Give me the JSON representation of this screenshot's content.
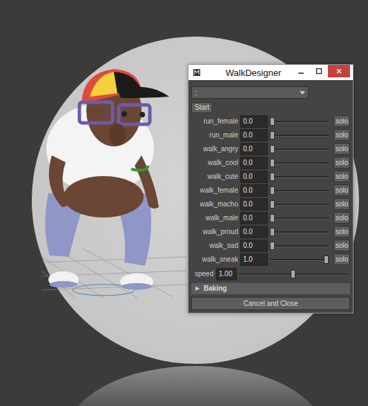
{
  "window": {
    "title": "WalkDesigner"
  },
  "dropdown": {
    "value": ":"
  },
  "start_button": {
    "label": "Start"
  },
  "presets": [
    {
      "name": "run_female",
      "value": "0.0",
      "level": 0,
      "button": "solo"
    },
    {
      "name": "run_male",
      "value": "0.0",
      "level": 0,
      "button": "solo"
    },
    {
      "name": "walk_angry",
      "value": "0.0",
      "level": 0,
      "button": "solo"
    },
    {
      "name": "walk_cool",
      "value": "0.0",
      "level": 0,
      "button": "solo"
    },
    {
      "name": "walk_cute",
      "value": "0.0",
      "level": 0,
      "button": "solo"
    },
    {
      "name": "walk_female",
      "value": "0.0",
      "level": 0,
      "button": "solo"
    },
    {
      "name": "walk_macho",
      "value": "0.0",
      "level": 0,
      "button": "solo"
    },
    {
      "name": "walk_male",
      "value": "0.0",
      "level": 0,
      "button": "solo"
    },
    {
      "name": "walk_proud",
      "value": "0.0",
      "level": 0,
      "button": "solo"
    },
    {
      "name": "walk_sad",
      "value": "0.0",
      "level": 0,
      "button": "solo"
    },
    {
      "name": "walk_sneak",
      "value": "1.0",
      "level": 1,
      "button": "solo"
    }
  ],
  "speed": {
    "label": "speed",
    "value": "1.00",
    "level": 0.5
  },
  "baking": {
    "icon": "▶",
    "label": "Baking",
    "expanded": false
  },
  "cancel_button": {
    "label": "Cancel and Close"
  }
}
